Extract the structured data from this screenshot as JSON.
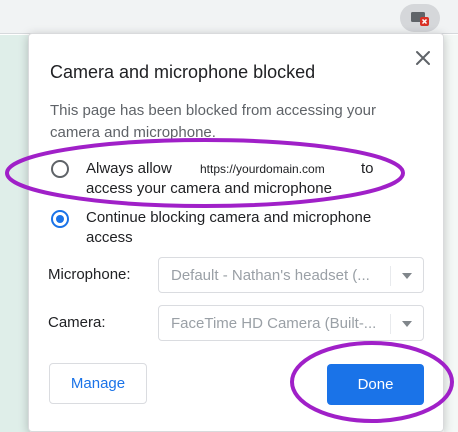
{
  "dialog": {
    "title": "Camera and microphone blocked",
    "description": "This page has been blocked from accessing your camera and microphone.",
    "close_icon": "close-icon"
  },
  "options": {
    "allow": {
      "label_prefix": "Always allow",
      "url": "https://yourdomain.com",
      "label_suffix": "to",
      "label_line2": "access your camera and microphone",
      "selected": false
    },
    "block": {
      "label": "Continue blocking camera and microphone access",
      "selected": true
    }
  },
  "fields": {
    "microphone": {
      "label": "Microphone:",
      "value": "Default - Nathan's headset (..."
    },
    "camera": {
      "label": "Camera:",
      "value": "FaceTime HD Camera (Built-..."
    }
  },
  "buttons": {
    "manage": "Manage",
    "done": "Done"
  },
  "toolbar": {
    "icon": "camera-blocked-icon"
  },
  "colors": {
    "accent": "#1a73e8",
    "annotation": "#a020c8",
    "blocked_badge": "#d93025"
  }
}
